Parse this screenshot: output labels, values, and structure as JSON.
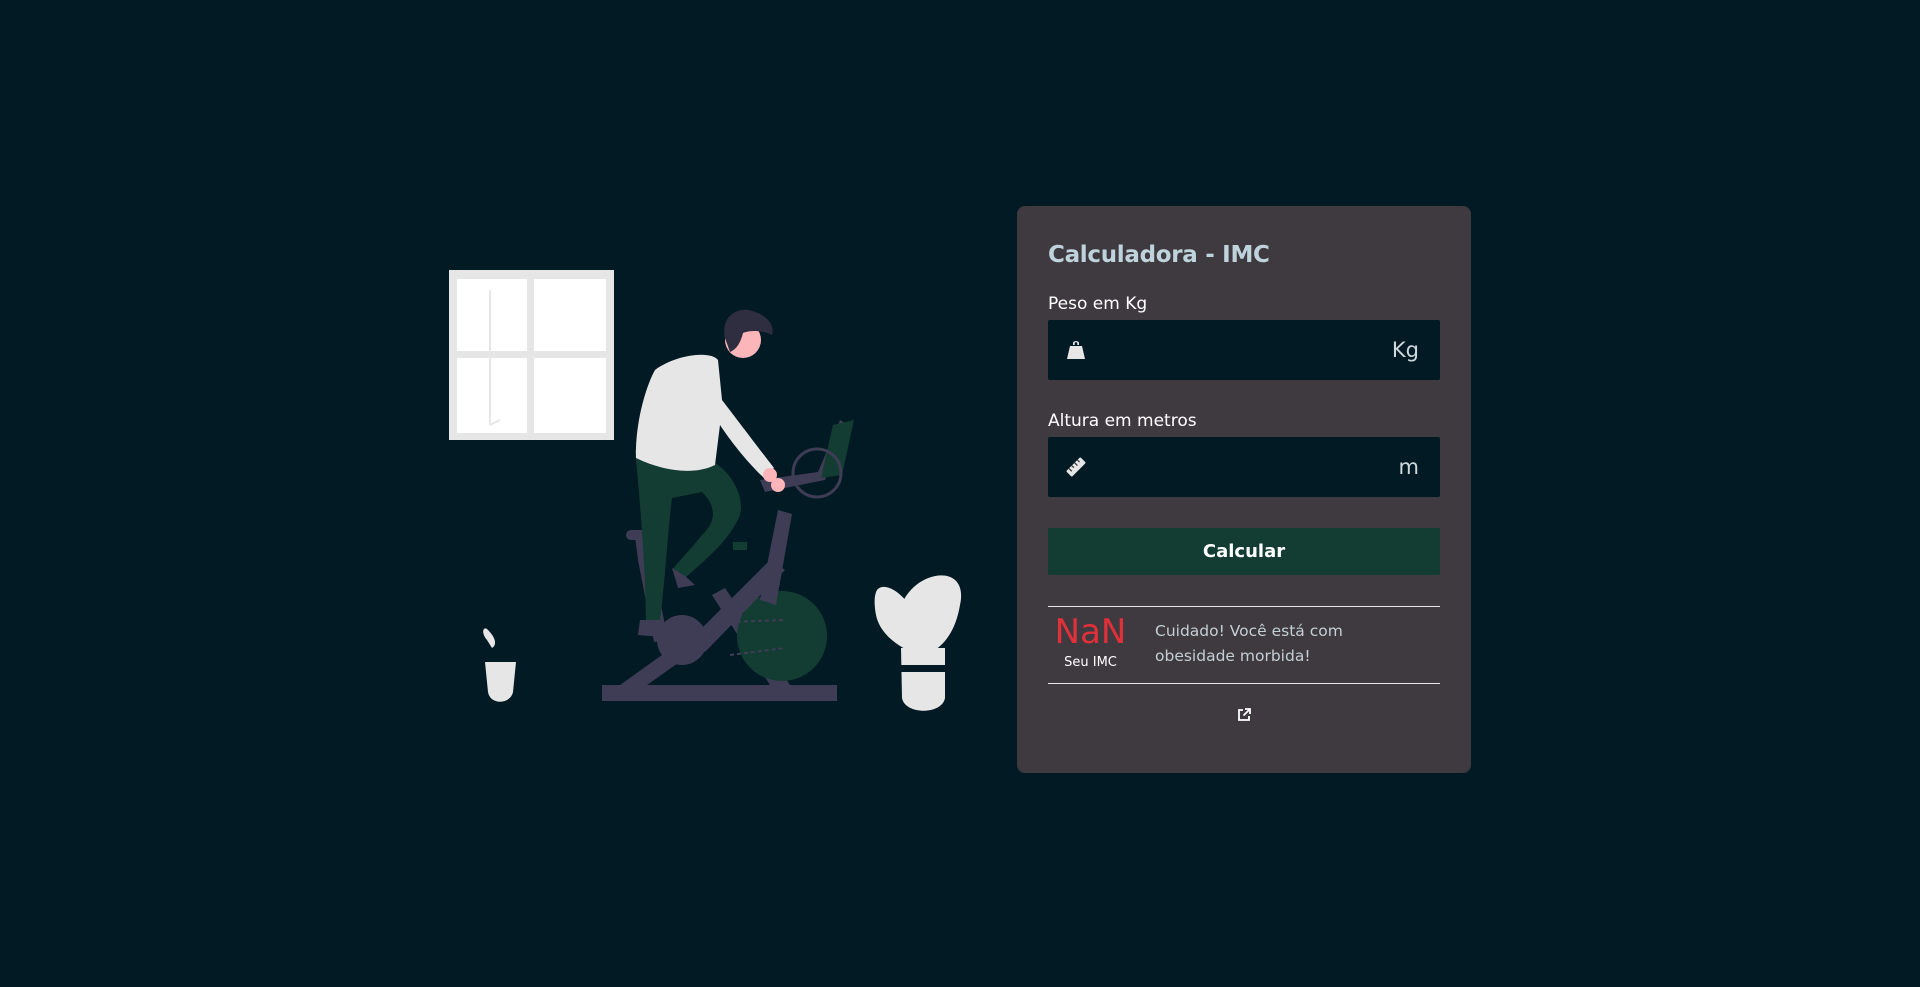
{
  "form": {
    "title": "Calculadora - IMC",
    "weight": {
      "label": "Peso em Kg",
      "value": "",
      "placeholder": "",
      "unit": "Kg",
      "icon": "weight-icon"
    },
    "height": {
      "label": "Altura em metros",
      "value": "",
      "placeholder": "",
      "unit": "m",
      "icon": "ruler-icon"
    },
    "button_label": "Calcular"
  },
  "result": {
    "value": "NaN",
    "label": "Seu IMC",
    "message": "Cuidado! Você está com obesidade morbida!"
  },
  "footer": {
    "link_icon": "external-link-icon"
  },
  "colors": {
    "background": "#021a24",
    "card": "#3f3a3f",
    "button": "#133d32",
    "result_value": "#e0303a",
    "title": "#bfd3dd"
  }
}
